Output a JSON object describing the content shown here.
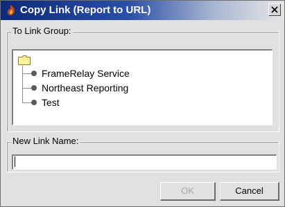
{
  "window": {
    "title": "Copy Link (Report to URL)",
    "close_glyph": "×",
    "icon": "app-flame-icon"
  },
  "link_group": {
    "label": "To Link Group:",
    "root_icon": "folder-icon",
    "items": [
      {
        "label": "FrameRelay Service",
        "icon": "bullet-icon"
      },
      {
        "label": "Northeast Reporting",
        "icon": "bullet-icon"
      },
      {
        "label": "Test",
        "icon": "bullet-icon"
      }
    ]
  },
  "new_link": {
    "label": "New Link Name:",
    "value": "",
    "placeholder": ""
  },
  "buttons": {
    "ok": {
      "label": "OK",
      "enabled": false
    },
    "cancel": {
      "label": "Cancel",
      "enabled": true
    }
  },
  "colors": {
    "titlebar_start": "#0c2a7a",
    "titlebar_end": "#e6e6e6",
    "dialog_bg": "#e1e1e1",
    "folder": "#fff3a0",
    "disabled_text": "#a8a8a8"
  }
}
